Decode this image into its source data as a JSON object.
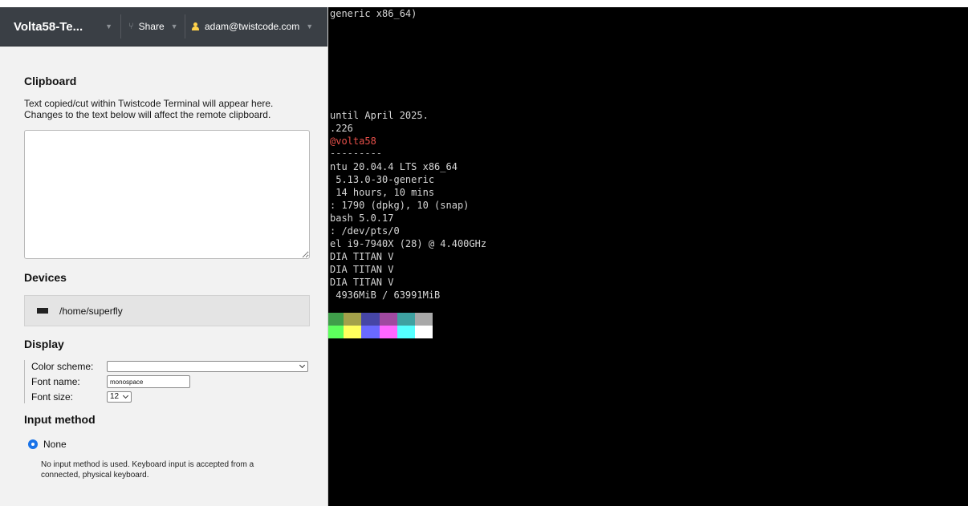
{
  "sidebar": {
    "topbar": {
      "title": "Volta58-Te...",
      "share_label": "Share",
      "user_email": "adam@twistcode.com"
    },
    "clipboard": {
      "heading": "Clipboard",
      "description_line1": "Text copied/cut within Twistcode Terminal will appear here.",
      "description_line2": "Changes to the text below will affect the remote clipboard.",
      "value": ""
    },
    "devices": {
      "heading": "Devices",
      "items": [
        {
          "icon": "drive-icon",
          "label": "/home/superfly"
        }
      ]
    },
    "display": {
      "heading": "Display",
      "color_scheme_label": "Color scheme:",
      "color_scheme_value": "",
      "font_name_label": "Font name:",
      "font_name_value": "monospace",
      "font_size_label": "Font size:",
      "font_size_value": "12"
    },
    "input_method": {
      "heading": "Input method",
      "option_label": "None",
      "option_description_line1": "No input method is used. Keyboard input is accepted from a",
      "option_description_line2": "connected, physical keyboard."
    }
  },
  "terminal": {
    "lines": [
      "generic x86_64)",
      "until April 2025.",
      ".226",
      "@volta58",
      "---------",
      "ntu 20.04.4 LTS x86_64",
      " 5.13.0-30-generic",
      " 14 hours, 10 mins",
      ": 1790 (dpkg), 10 (snap)",
      "bash 5.0.17",
      ": /dev/pts/0",
      "el i9-7940X (28) @ 4.400GHz",
      "DIA TITAN V",
      "DIA TITAN V",
      "DIA TITAN V",
      " 4936MiB / 63991MiB"
    ],
    "colors": {
      "accent_red": "#e8504a",
      "palette_dark": [
        "#3f9e4a",
        "#a3a14a",
        "#4646a6",
        "#a049a0",
        "#3ea1a1",
        "#a8a8a8"
      ],
      "palette_bright": [
        "#5dff5d",
        "#ffff5d",
        "#6a6aff",
        "#ff66ff",
        "#55ffff",
        "#ffffff"
      ]
    }
  }
}
